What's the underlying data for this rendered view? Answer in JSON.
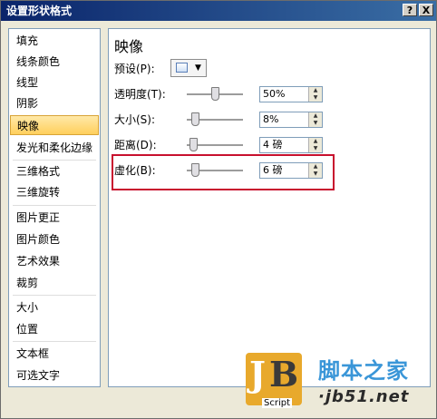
{
  "window": {
    "title": "设置形状格式",
    "help_label": "?",
    "close_label": "X"
  },
  "sidebar": {
    "items": [
      {
        "label": "填充"
      },
      {
        "label": "线条颜色"
      },
      {
        "label": "线型"
      },
      {
        "label": "阴影"
      },
      {
        "label": "映像",
        "selected": true
      },
      {
        "label": "发光和柔化边缘"
      },
      {
        "label": "三维格式"
      },
      {
        "label": "三维旋转"
      },
      {
        "label": "图片更正"
      },
      {
        "label": "图片颜色"
      },
      {
        "label": "艺术效果"
      },
      {
        "label": "裁剪"
      },
      {
        "label": "大小"
      },
      {
        "label": "位置"
      },
      {
        "label": "文本框"
      },
      {
        "label": "可选文字"
      }
    ]
  },
  "panel": {
    "title": "映像",
    "preset": {
      "label": "预设(P):",
      "arrow": "▼"
    },
    "rows": [
      {
        "label": "透明度(T):",
        "value": "50%",
        "slider_level": 0.5
      },
      {
        "label": "大小(S):",
        "value": "8%",
        "slider_level": 0.1
      },
      {
        "label": "距离(D):",
        "value": "4 磅",
        "slider_level": 0.05
      },
      {
        "label": "虚化(B):",
        "value": "6 磅",
        "slider_level": 0.1
      }
    ]
  },
  "watermark": {
    "logo_j": "J",
    "logo_b": "B",
    "script": "Script",
    "cn": "脚本之家",
    "url": "·jb51.net"
  },
  "colors": {
    "accent_selected": "#ffd97a",
    "highlight_box": "#c8102e",
    "title_bar": "#0a246a"
  }
}
